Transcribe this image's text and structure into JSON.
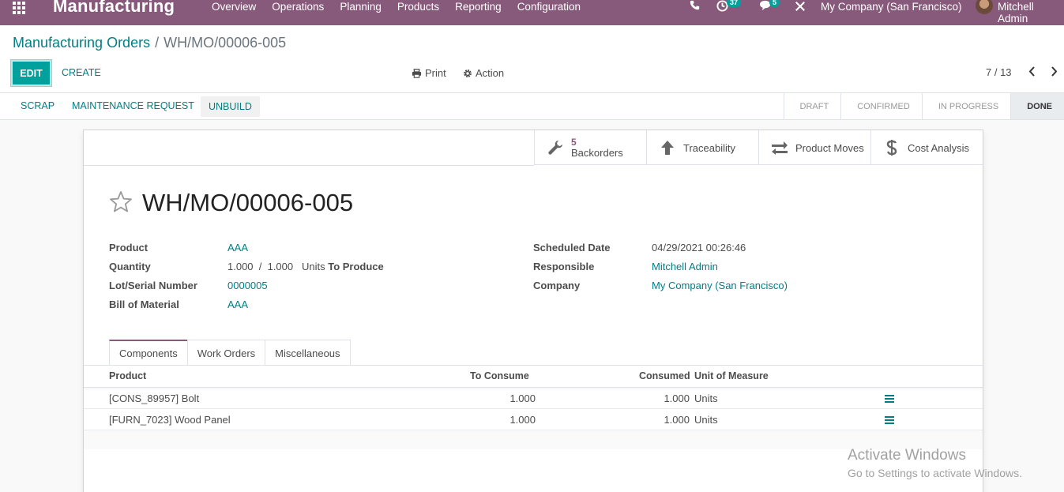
{
  "navbar": {
    "brand": "Manufacturing",
    "menu": [
      "Overview",
      "Operations",
      "Planning",
      "Products",
      "Reporting",
      "Configuration"
    ],
    "activity_count": "37",
    "message_count": "5",
    "company": "My Company (San Francisco)",
    "user": "Mitchell Admin"
  },
  "breadcrumb": {
    "parent": "Manufacturing Orders",
    "separator": "/",
    "current": "WH/MO/00006-005"
  },
  "toolbar": {
    "edit": "EDIT",
    "create": "CREATE",
    "print": "Print",
    "action": "Action",
    "pager": "7 / 13"
  },
  "statusbar": {
    "buttons": [
      "SCRAP",
      "MAINTENANCE REQUEST",
      "UNBUILD"
    ],
    "stages": [
      "DRAFT",
      "CONFIRMED",
      "IN PROGRESS",
      "DONE"
    ],
    "active_stage": "DONE"
  },
  "smart_buttons": {
    "backorders_count": "5",
    "backorders": "Backorders",
    "traceability": "Traceability",
    "product_moves": "Product Moves",
    "cost_analysis": "Cost Analysis"
  },
  "record": {
    "title": "WH/MO/00006-005",
    "fields_left": [
      {
        "label": "Product",
        "value": "AAA"
      },
      {
        "label": "Quantity",
        "value": "1.000  /  1.000",
        "unit": "Units",
        "suffix": "To Produce"
      },
      {
        "label": "Lot/Serial Number",
        "value": "0000005"
      },
      {
        "label": "Bill of Material",
        "value": "AAA"
      }
    ],
    "fields_right": [
      {
        "label": "Scheduled Date",
        "value": "04/29/2021 00:26:46"
      },
      {
        "label": "Responsible",
        "value": "Mitchell Admin"
      },
      {
        "label": "Company",
        "value": "My Company (San Francisco)"
      }
    ]
  },
  "tabs": [
    "Components",
    "Work Orders",
    "Miscellaneous"
  ],
  "components_table": {
    "headers": [
      "Product",
      "To Consume",
      "Consumed",
      "Unit of Measure"
    ],
    "rows": [
      {
        "product": "[CONS_89957] Bolt",
        "to_consume": "1.000",
        "consumed": "1.000",
        "uom": "Units"
      },
      {
        "product": "[FURN_7023] Wood Panel",
        "to_consume": "1.000",
        "consumed": "1.000",
        "uom": "Units"
      }
    ]
  },
  "watermark": {
    "line1": "Activate Windows",
    "line2": "Go to Settings to activate Windows."
  },
  "colors": {
    "navbar": "#875a7b",
    "primary": "#00a09d",
    "link": "#017e84"
  }
}
